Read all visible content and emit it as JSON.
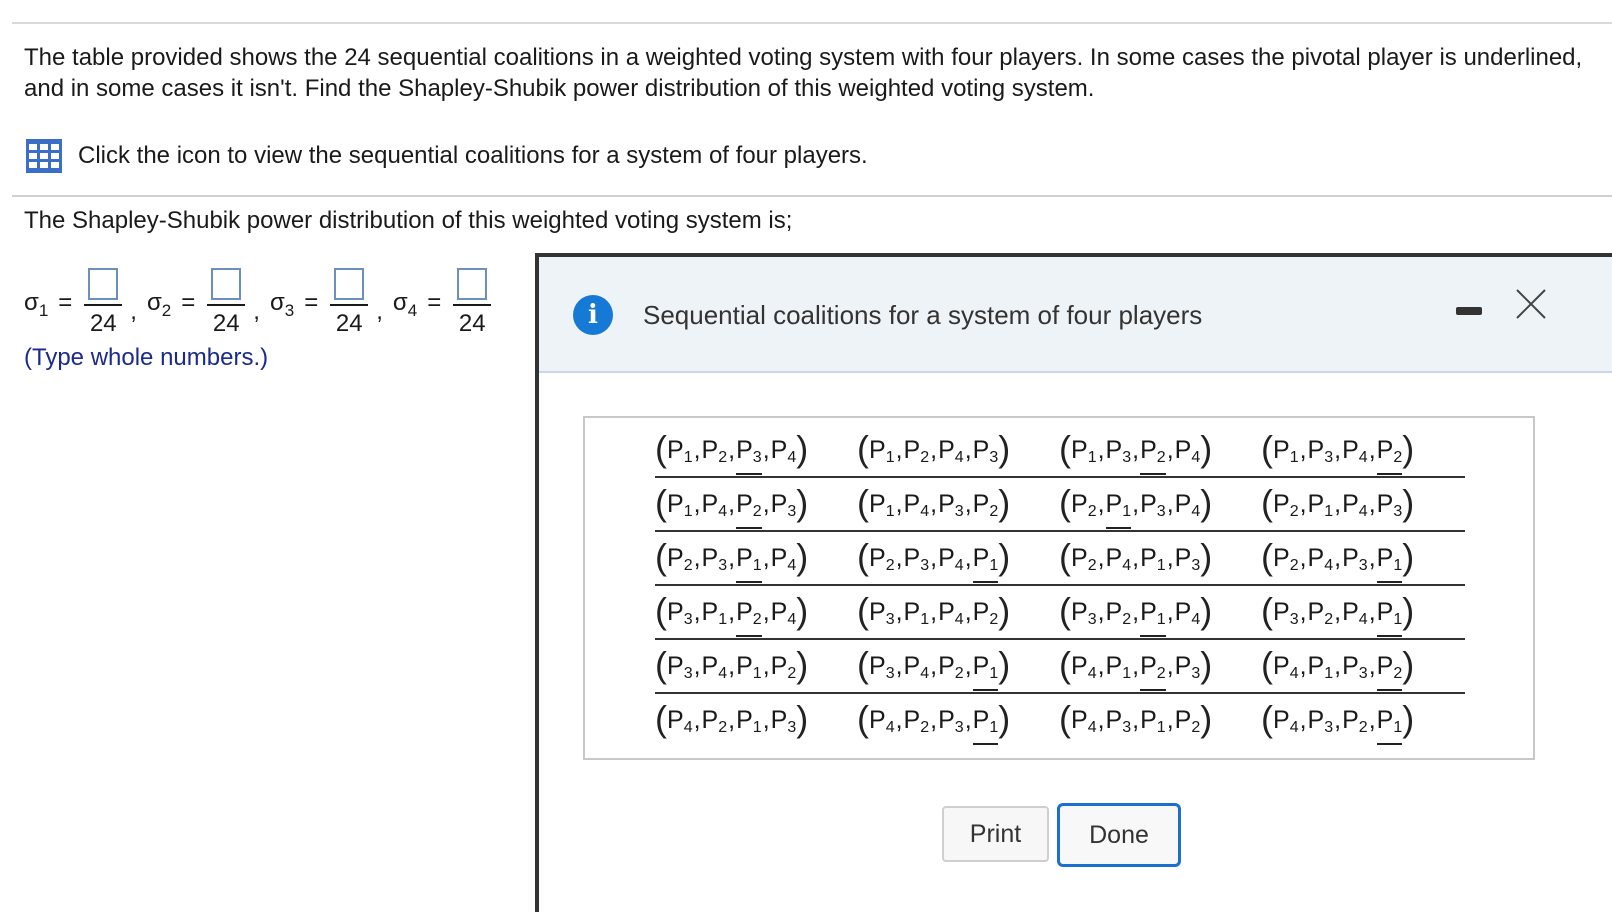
{
  "question": "The table provided shows the 24 sequential coalitions in a weighted voting system with four players. In some cases the pivotal player is underlined, and in some cases it isn't. Find the Shapley-Shubik power distribution of this weighted voting system.",
  "icon_row": {
    "icon": "table-grid-icon",
    "label": "Click the icon to view the sequential coalitions for a system of four players."
  },
  "prompt": "The Shapley-Shubik power distribution of this weighted voting system is;",
  "answers": [
    {
      "sigma": "σ",
      "sub": "1",
      "eq": "=",
      "denominator": "24",
      "value": "",
      "comma": ","
    },
    {
      "sigma": "σ",
      "sub": "2",
      "eq": "=",
      "denominator": "24",
      "value": "",
      "comma": ","
    },
    {
      "sigma": "σ",
      "sub": "3",
      "eq": "=",
      "denominator": "24",
      "value": "",
      "comma": ","
    },
    {
      "sigma": "σ",
      "sub": "4",
      "eq": "=",
      "denominator": "24",
      "value": ""
    }
  ],
  "hint": "(Type whole numbers.)",
  "popup": {
    "title": "Sequential coalitions for a system of four players",
    "info_icon": "info-icon",
    "minimize_icon": "minimize-icon",
    "close_icon": "close-icon",
    "coalitions": [
      [
        {
          "order": [
            1,
            2,
            3,
            4
          ],
          "pivot": 2
        },
        {
          "order": [
            1,
            2,
            4,
            3
          ],
          "pivot": null
        },
        {
          "order": [
            1,
            3,
            2,
            4
          ],
          "pivot": 2
        },
        {
          "order": [
            1,
            3,
            4,
            2
          ],
          "pivot": 3
        }
      ],
      [
        {
          "order": [
            1,
            4,
            2,
            3
          ],
          "pivot": 2
        },
        {
          "order": [
            1,
            4,
            3,
            2
          ],
          "pivot": null
        },
        {
          "order": [
            2,
            1,
            3,
            4
          ],
          "pivot": 1
        },
        {
          "order": [
            2,
            1,
            4,
            3
          ],
          "pivot": null
        }
      ],
      [
        {
          "order": [
            2,
            3,
            1,
            4
          ],
          "pivot": 2
        },
        {
          "order": [
            2,
            3,
            4,
            1
          ],
          "pivot": 3
        },
        {
          "order": [
            2,
            4,
            1,
            3
          ],
          "pivot": null
        },
        {
          "order": [
            2,
            4,
            3,
            1
          ],
          "pivot": 3
        }
      ],
      [
        {
          "order": [
            3,
            1,
            2,
            4
          ],
          "pivot": 2
        },
        {
          "order": [
            3,
            1,
            4,
            2
          ],
          "pivot": null
        },
        {
          "order": [
            3,
            2,
            1,
            4
          ],
          "pivot": 2
        },
        {
          "order": [
            3,
            2,
            4,
            1
          ],
          "pivot": 3
        }
      ],
      [
        {
          "order": [
            3,
            4,
            1,
            2
          ],
          "pivot": null
        },
        {
          "order": [
            3,
            4,
            2,
            1
          ],
          "pivot": 3
        },
        {
          "order": [
            4,
            1,
            2,
            3
          ],
          "pivot": 2
        },
        {
          "order": [
            4,
            1,
            3,
            2
          ],
          "pivot": 3
        }
      ],
      [
        {
          "order": [
            4,
            2,
            1,
            3
          ],
          "pivot": null
        },
        {
          "order": [
            4,
            2,
            3,
            1
          ],
          "pivot": 3
        },
        {
          "order": [
            4,
            3,
            1,
            2
          ],
          "pivot": null
        },
        {
          "order": [
            4,
            3,
            2,
            1
          ],
          "pivot": 3
        }
      ]
    ],
    "player_letter": "P",
    "print_label": "Print",
    "done_label": "Done"
  }
}
